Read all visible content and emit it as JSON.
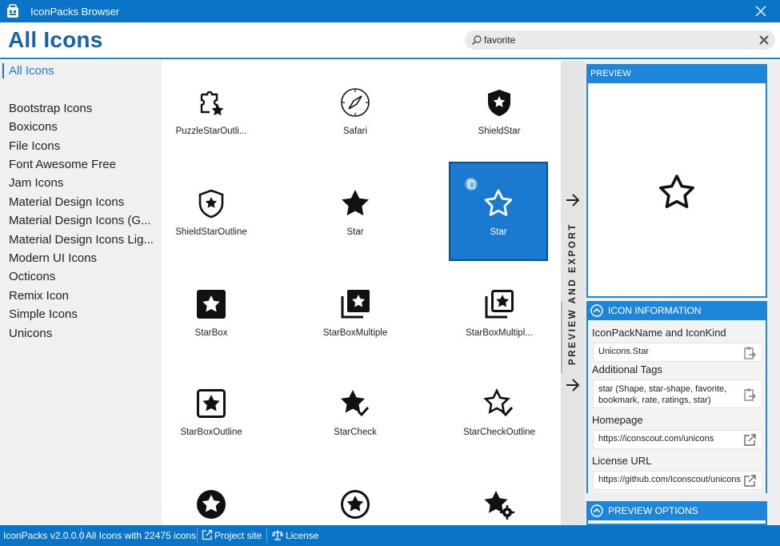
{
  "window": {
    "title": "IconPacks Browser"
  },
  "header": {
    "page_title": "All Icons"
  },
  "search": {
    "value": "favorite",
    "icon": "search-icon"
  },
  "sidebar": {
    "items": [
      {
        "label": "All Icons",
        "selected": true
      },
      {
        "label": "Bootstrap Icons"
      },
      {
        "label": "Boxicons"
      },
      {
        "label": "File Icons"
      },
      {
        "label": "Font Awesome Free"
      },
      {
        "label": "Jam Icons"
      },
      {
        "label": "Material Design Icons"
      },
      {
        "label": "Material Design Icons (G..."
      },
      {
        "label": "Material Design Icons Lig..."
      },
      {
        "label": "Modern UI Icons"
      },
      {
        "label": "Octicons"
      },
      {
        "label": "Remix Icon"
      },
      {
        "label": "Simple Icons"
      },
      {
        "label": "Unicons"
      }
    ]
  },
  "grid": {
    "tiles": [
      {
        "label": "PuzzleStarOutli...",
        "icon": "puzzle-star-outline-icon"
      },
      {
        "label": "Safari",
        "icon": "safari-icon"
      },
      {
        "label": "ShieldStar",
        "icon": "shield-star-icon"
      },
      {
        "label": "ShieldStarOutline",
        "icon": "shield-star-outline-icon"
      },
      {
        "label": "Star",
        "icon": "star-icon"
      },
      {
        "label": "Star",
        "icon": "star-outline-icon",
        "selected": true
      },
      {
        "label": "StarBox",
        "icon": "star-box-icon"
      },
      {
        "label": "StarBoxMultiple",
        "icon": "star-box-multiple-icon"
      },
      {
        "label": "StarBoxMultipl...",
        "icon": "star-box-multiple-outline-icon"
      },
      {
        "label": "StarBoxOutline",
        "icon": "star-box-outline-icon"
      },
      {
        "label": "StarCheck",
        "icon": "star-check-icon"
      },
      {
        "label": "StarCheckOutline",
        "icon": "star-check-outline-icon"
      },
      {
        "label": "",
        "icon": "star-circle-icon"
      },
      {
        "label": "",
        "icon": "star-circle-outline-icon"
      },
      {
        "label": "",
        "icon": "star-cog-icon"
      }
    ]
  },
  "strip": {
    "label": "PREVIEW AND EXPORT"
  },
  "preview": {
    "header": "PREVIEW"
  },
  "icon_info": {
    "header": "ICON INFORMATION",
    "name_label": "IconPackName and IconKind",
    "name_value": "Unicons.Star",
    "tags_label": "Additional Tags",
    "tags_value": "star (Shape, star-shape, favorite, bookmark, rate, ratings, star)",
    "homepage_label": "Homepage",
    "homepage_value": "https://iconscout.com/unicons",
    "license_label": "License URL",
    "license_value": "https://github.com/Iconscout/unicons"
  },
  "preview_options": {
    "header": "PREVIEW OPTIONS"
  },
  "status": {
    "version": "IconPacks v2.0.0.0",
    "count": "All Icons with 22475 icons",
    "project_site": "Project site",
    "license": "License"
  },
  "colors": {
    "accent": "#0a74c8",
    "selected_tile": "#1a7ad0",
    "title": "#1663a9"
  }
}
